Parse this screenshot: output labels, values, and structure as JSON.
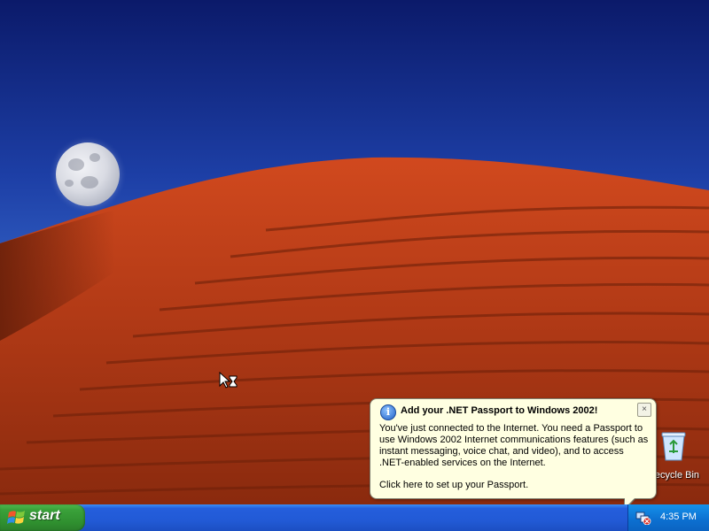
{
  "desktop": {
    "icons": [
      {
        "label": "Recycle Bin",
        "icon": "recycle-bin-icon"
      }
    ]
  },
  "balloon": {
    "title": "Add your .NET Passport to Windows 2002!",
    "body": "You've just connected to the Internet.  You need a Passport to use Windows 2002 Internet communications features (such as instant messaging, voice chat, and video), and to access .NET-enabled services on the Internet.",
    "link": "Click here to set up your Passport.",
    "icon": "info-icon",
    "close_label": "×"
  },
  "taskbar": {
    "start_label": "start",
    "clock": "4:35 PM",
    "tray_icon": "network-connection-icon"
  },
  "colors": {
    "sky": "#1d3fa6",
    "dune": "#b5401a",
    "taskbar": "#245edc",
    "start_button": "#3aa13a",
    "balloon_bg": "#ffffe1"
  }
}
